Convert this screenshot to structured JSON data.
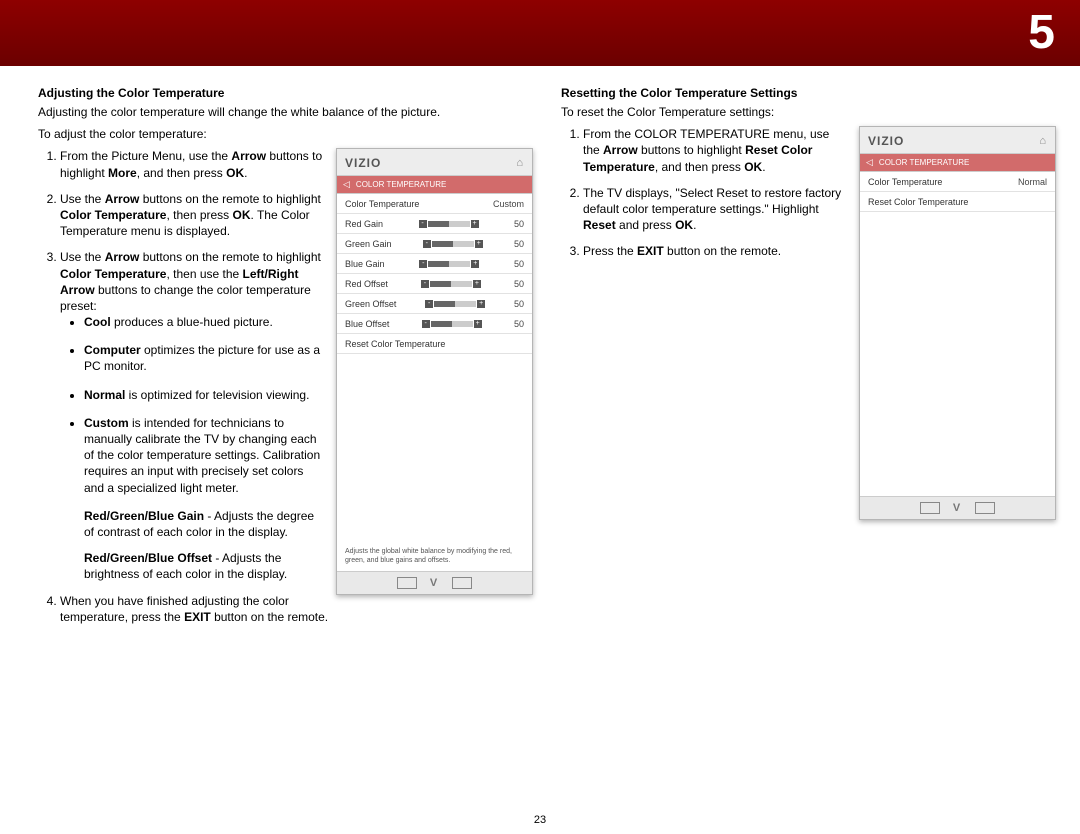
{
  "chapter": "5",
  "pageNumber": "23",
  "left": {
    "heading": "Adjusting the Color Temperature",
    "intro": "Adjusting the color temperature will change the white balance of the picture.",
    "lead": "To adjust the color temperature:",
    "s1a": "From the Picture Menu, use the ",
    "s1b": "Arrow",
    "s1c": " buttons to highlight ",
    "s1d": "More",
    "s1e": ", and then press ",
    "s1f": "OK",
    "s1g": ".",
    "s2a": "Use the ",
    "s2b": "Arrow",
    "s2c": " buttons on the remote to highlight ",
    "s2d": "Color Temperature",
    "s2e": ", then press ",
    "s2f": "OK",
    "s2g": ". The Color Temperature menu is displayed.",
    "s3a": "Use the ",
    "s3b": "Arrow",
    "s3c": " buttons on the remote to highlight ",
    "s3d": "Color Temperature",
    "s3e": ", then use the ",
    "s3f": "Left/Right Arrow",
    "s3g": " buttons to change the color temperature preset:",
    "pCoolA": "Cool",
    "pCoolB": " produces a blue-hued picture.",
    "pCompA": "Computer",
    "pCompB": " optimizes the picture for use as a PC monitor.",
    "pNormA": "Normal",
    "pNormB": " is optimized for television viewing.",
    "pCustA": "Custom",
    "pCustB": " is intended for technicians to manually calibrate the TV by changing each of the color temperature settings. Calibration requires an input with precisely set colors and a specialized light meter.",
    "gainA": "Red/Green/Blue Gain",
    "gainB": " - Adjusts the degree of contrast of each color in the display.",
    "offA": "Red/Green/Blue Offset",
    "offB": " - Adjusts the brightness of each color in the display.",
    "s4a": "When you have finished adjusting the color temperature, press the ",
    "s4b": "EXIT",
    "s4c": " button on the remote."
  },
  "right": {
    "heading": "Resetting the Color Temperature Settings",
    "lead": "To reset the Color Temperature settings:",
    "s1a": "From the COLOR TEMPERATURE menu, use the ",
    "s1b": "Arrow",
    "s1c": " buttons to highlight ",
    "s1d": "Reset Color Temperature",
    "s1e": ", and then press ",
    "s1f": "OK",
    "s1g": ".",
    "s2a": "The TV displays, \"Select Reset to restore factory default color temperature settings.\" Highlight ",
    "s2b": "Reset",
    "s2c": " and press ",
    "s2d": "OK",
    "s2e": ".",
    "s3a": "Press the ",
    "s3b": "EXIT",
    "s3c": " button on the remote."
  },
  "osd1": {
    "brand": "VIZIO",
    "crumb": "COLOR TEMPERATURE",
    "rows": [
      {
        "label": "Color Temperature",
        "value": "Custom"
      },
      {
        "label": "Red Gain",
        "value": "50",
        "slider": true
      },
      {
        "label": "Green Gain",
        "value": "50",
        "slider": true
      },
      {
        "label": "Blue Gain",
        "value": "50",
        "slider": true
      },
      {
        "label": "Red Offset",
        "value": "50",
        "slider": true
      },
      {
        "label": "Green Offset",
        "value": "50",
        "slider": true
      },
      {
        "label": "Blue Offset",
        "value": "50",
        "slider": true
      },
      {
        "label": "Reset Color Temperature",
        "value": ""
      }
    ],
    "help": "Adjusts the global white balance by modifying the red, green, and blue gains and offsets."
  },
  "osd2": {
    "brand": "VIZIO",
    "crumb": "COLOR TEMPERATURE",
    "rows": [
      {
        "label": "Color Temperature",
        "value": "Normal"
      },
      {
        "label": "Reset Color Temperature",
        "value": ""
      }
    ]
  }
}
